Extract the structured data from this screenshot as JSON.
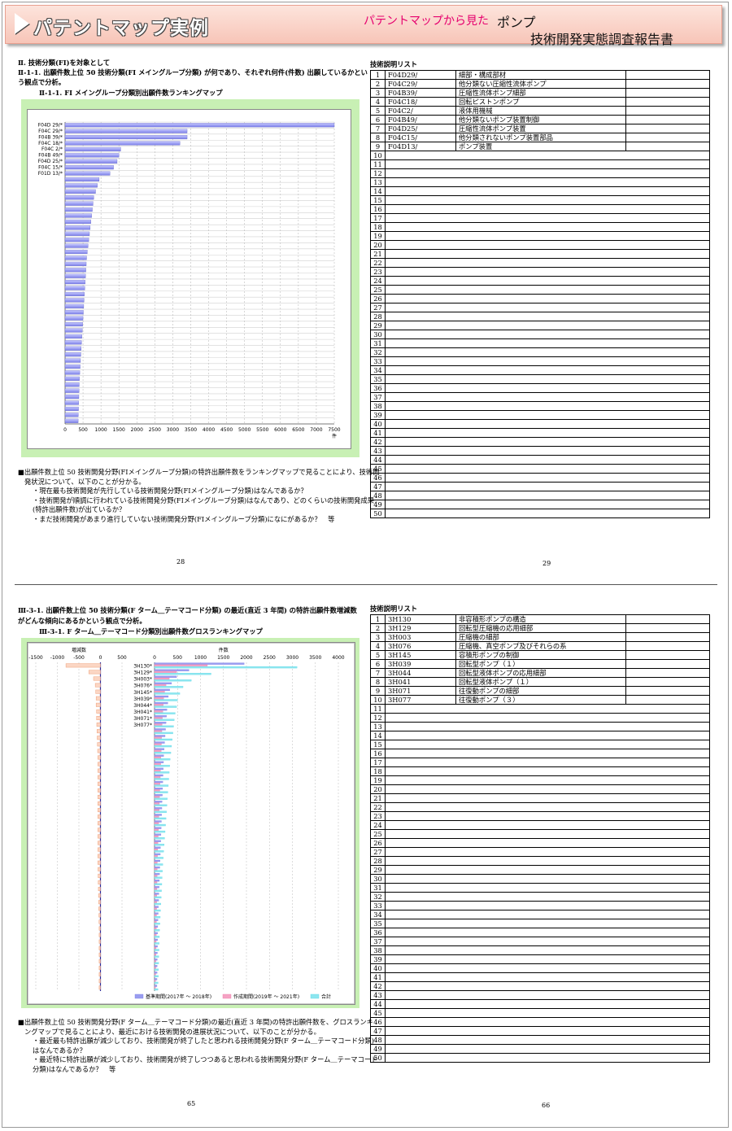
{
  "banner": {
    "title": "パテントマップ実例",
    "subtitle": "パテントマップから見た",
    "topic": "ポンプ",
    "report": "技術開発実態調査報告書"
  },
  "page1": {
    "heading": "Ⅱ. 技術分類(FI)を対象として",
    "q_line1": "Ⅱ-1-1. 出願件数上位 50 技術分類(FI メイングループ分類) が何であり、それぞれ何件(件数) 出願しているかとい",
    "q_line2": "う観点で分析。",
    "chart_caption": "Ⅱ-1-1. FI メイングループ分類別出願件数ランキングマップ",
    "desc_lines": [
      "■出願件数上位 50 技術開発分野(FIメイングループ分類)の特許出願件数をランキングマップで見ることにより、技術開",
      "発状況について、以下のことが分かる。",
      "・現在最も技術開発が先行している技術開発分野(FIメイングループ分類)はなんであるか？",
      "・技術開発が順調に行われている技術開発分野(FIメイングループ分類)はなんであり、どのくらいの技術開発成果",
      "(特許出願件数)が出ているか？",
      "・まだ技術開発があまり進行していない技術開発分野(FIメイングループ分類)になにがあるか？　等"
    ],
    "page_left": "28",
    "page_right": "29",
    "list_title": "技術説明リスト"
  },
  "page2": {
    "q_line1": "Ⅲ-3-1. 出願件数上位 50 技術分類(F ターム＿テーマコード分類) の最近(直近 3 年間) の特許出願件数増減数",
    "q_line2": "がどんな傾向にあるかという観点で分析。",
    "chart_caption": "Ⅲ-3-1. F ターム＿テーマコード分類別出願件数グロスランキングマップ",
    "desc_lines": [
      "■出願件数上位 50 技術開発分野(F ターム＿テーマコード分類)の最近(直近 3 年間)の特許出願件数を、グロスランキ",
      "ングマップで見ることにより、最近における技術開発の進展状況について、以下のことが分かる。",
      "・最近最も特許出願が減少しており、技術開発が終了したと思われる技術開発分野(F ターム＿テーマコード分類)",
      "はなんであるか？",
      "・最近特に特許出願が減少しており、技術開発が終了しつつあると思われる技術開発分野(F ターム＿テーマコード",
      "分類)はなんであるか？　等"
    ],
    "page_left": "65",
    "page_right": "66",
    "list_title": "技術説明リスト"
  },
  "chart_data": [
    {
      "type": "bar",
      "title": "",
      "xlabel": "件",
      "xlim": [
        0,
        7500
      ],
      "xticks": [
        0,
        500,
        1000,
        1500,
        2000,
        2500,
        3000,
        3500,
        4000,
        4500,
        5000,
        5500,
        6000,
        6500,
        7000,
        7500
      ],
      "categories": [
        "F04D 29/*",
        "F04C 29/*",
        "F04B 39/*",
        "F04C 18/*",
        "F04C  2/*",
        "F04B 49/*",
        "F04D 25/*",
        "F04C 15/*",
        "F01D 13/*"
      ],
      "values": [
        7500,
        3400,
        3400,
        3200,
        1550,
        1500,
        1450,
        1350,
        1250,
        950,
        900,
        850,
        800,
        780,
        760,
        740,
        720,
        700,
        680,
        660,
        640,
        620,
        600,
        590,
        580,
        570,
        560,
        550,
        540,
        530,
        520,
        510,
        500,
        490,
        480,
        470,
        460,
        450,
        440,
        430,
        420,
        410,
        400,
        395,
        390,
        385,
        380,
        375,
        370,
        365
      ]
    },
    {
      "type": "bar",
      "title": "",
      "xlabel": "件数",
      "x2label": "増減数",
      "xlim": [
        0,
        4000
      ],
      "xticks": [
        0,
        500,
        1000,
        1500,
        2000,
        2500,
        3000,
        3500,
        4000
      ],
      "diff_xlim": [
        -1500,
        500
      ],
      "diff_xticks": [
        -1500,
        -1000,
        -500,
        0,
        500
      ],
      "categories": [
        "3H130*",
        "3H129*",
        "3H003*",
        "3H076*",
        "3H145*",
        "3H039*",
        "3H044*",
        "3H041*",
        "3H071*",
        "3H077*"
      ],
      "legend": [
        "基準期間(2017年 〜 2018年)",
        "作成期間(2019年 〜 2021年)",
        "合計"
      ],
      "series": [
        {
          "name": "基準期間(2017年 〜 2018年)",
          "values": [
            1950,
            750,
            480,
            370,
            330,
            300,
            290,
            270,
            260,
            250,
            240,
            230,
            220,
            210,
            200,
            195,
            190,
            185,
            180,
            175,
            170,
            165,
            160,
            155,
            150,
            145,
            140,
            135,
            130,
            125,
            120,
            115,
            110,
            105,
            100,
            95,
            90,
            85,
            80,
            75,
            70,
            68,
            66,
            64,
            62,
            60,
            58,
            56,
            54,
            52
          ]
        },
        {
          "name": "作成期間(2019年 〜 2021年)",
          "values": [
            1150,
            480,
            320,
            250,
            220,
            200,
            190,
            180,
            170,
            165,
            160,
            155,
            150,
            145,
            140,
            135,
            130,
            125,
            120,
            115,
            110,
            105,
            100,
            95,
            90,
            85,
            80,
            75,
            70,
            65,
            60,
            58,
            56,
            54,
            52,
            50,
            48,
            46,
            44,
            42,
            40,
            38,
            36,
            34,
            32,
            30,
            28,
            26,
            24,
            22
          ]
        },
        {
          "name": "合計",
          "values": [
            3100,
            1230,
            800,
            620,
            550,
            500,
            480,
            450,
            430,
            415,
            400,
            385,
            370,
            355,
            340,
            330,
            320,
            310,
            300,
            290,
            280,
            270,
            260,
            250,
            240,
            230,
            220,
            210,
            200,
            190,
            180,
            173,
            166,
            159,
            152,
            145,
            138,
            131,
            124,
            117,
            110,
            106,
            102,
            98,
            94,
            90,
            86,
            82,
            78,
            74
          ]
        },
        {
          "name": "増減数",
          "values": [
            -800,
            -270,
            -160,
            -120,
            -110,
            -100,
            -100,
            -90,
            -90,
            -85,
            -80,
            -75,
            -70,
            -65,
            -60,
            -60,
            -60,
            -60,
            -60,
            -60,
            -60,
            -60,
            -60,
            -60,
            -60,
            -60,
            -60,
            -60,
            -60,
            -60,
            -60,
            -57,
            -54,
            -51,
            -48,
            -45,
            -42,
            -39,
            -36,
            -33,
            -30,
            -30,
            -30,
            -30,
            -30,
            -30,
            -30,
            -30,
            -30,
            -30
          ]
        }
      ]
    }
  ],
  "list1": {
    "rows": [
      {
        "n": "1",
        "code": "F04D29/",
        "desc": "細部・構成部材"
      },
      {
        "n": "2",
        "code": "F04C29/",
        "desc": "他分類ない圧縮性流体ポンプ"
      },
      {
        "n": "3",
        "code": "F04B39/",
        "desc": "圧縮性流体ポンプ細部"
      },
      {
        "n": "4",
        "code": "F04C18/",
        "desc": "回転ピストンポンプ"
      },
      {
        "n": "5",
        "code": "F04C2/",
        "desc": "液体用機械"
      },
      {
        "n": "6",
        "code": "F04B49/",
        "desc": "他分類ないポンプ装置制御"
      },
      {
        "n": "7",
        "code": "F04D25/",
        "desc": "圧縮性流体ポンプ装置"
      },
      {
        "n": "8",
        "code": "F04C15/",
        "desc": "他分類されないポンプ装置部品"
      },
      {
        "n": "9",
        "code": "F04D13/",
        "desc": "ポンプ装置"
      },
      {
        "n": "10",
        "code": "",
        "desc": ""
      },
      {
        "n": "11",
        "code": "",
        "desc": ""
      },
      {
        "n": "12",
        "code": "",
        "desc": ""
      },
      {
        "n": "13",
        "code": "",
        "desc": ""
      },
      {
        "n": "14",
        "code": "",
        "desc": ""
      },
      {
        "n": "15",
        "code": "",
        "desc": ""
      },
      {
        "n": "16",
        "code": "",
        "desc": ""
      },
      {
        "n": "17",
        "code": "",
        "desc": ""
      },
      {
        "n": "18",
        "code": "",
        "desc": ""
      },
      {
        "n": "19",
        "code": "",
        "desc": ""
      },
      {
        "n": "20",
        "code": "",
        "desc": ""
      },
      {
        "n": "21",
        "code": "",
        "desc": ""
      },
      {
        "n": "22",
        "code": "",
        "desc": ""
      },
      {
        "n": "23",
        "code": "",
        "desc": ""
      },
      {
        "n": "24",
        "code": "",
        "desc": ""
      },
      {
        "n": "25",
        "code": "",
        "desc": ""
      },
      {
        "n": "26",
        "code": "",
        "desc": ""
      },
      {
        "n": "27",
        "code": "",
        "desc": ""
      },
      {
        "n": "28",
        "code": "",
        "desc": ""
      },
      {
        "n": "29",
        "code": "",
        "desc": ""
      },
      {
        "n": "30",
        "code": "",
        "desc": ""
      },
      {
        "n": "31",
        "code": "",
        "desc": ""
      },
      {
        "n": "32",
        "code": "",
        "desc": ""
      },
      {
        "n": "33",
        "code": "",
        "desc": ""
      },
      {
        "n": "34",
        "code": "",
        "desc": ""
      },
      {
        "n": "35",
        "code": "",
        "desc": ""
      },
      {
        "n": "36",
        "code": "",
        "desc": ""
      },
      {
        "n": "37",
        "code": "",
        "desc": ""
      },
      {
        "n": "38",
        "code": "",
        "desc": ""
      },
      {
        "n": "39",
        "code": "",
        "desc": ""
      },
      {
        "n": "40",
        "code": "",
        "desc": ""
      },
      {
        "n": "41",
        "code": "",
        "desc": ""
      },
      {
        "n": "42",
        "code": "",
        "desc": ""
      },
      {
        "n": "43",
        "code": "",
        "desc": ""
      },
      {
        "n": "44",
        "code": "",
        "desc": ""
      },
      {
        "n": "45",
        "code": "",
        "desc": ""
      },
      {
        "n": "46",
        "code": "",
        "desc": ""
      },
      {
        "n": "47",
        "code": "",
        "desc": ""
      },
      {
        "n": "48",
        "code": "",
        "desc": ""
      },
      {
        "n": "49",
        "code": "",
        "desc": ""
      },
      {
        "n": "50",
        "code": "",
        "desc": ""
      }
    ]
  },
  "list2": {
    "rows": [
      {
        "n": "1",
        "code": "3H130",
        "desc": "非容積形ポンプの構造"
      },
      {
        "n": "2",
        "code": "3H129",
        "desc": "回転型圧縮機の応用細部"
      },
      {
        "n": "3",
        "code": "3H003",
        "desc": "圧縮機の細部"
      },
      {
        "n": "4",
        "code": "3H076",
        "desc": "圧縮機、真空ポンプ及びそれらの系"
      },
      {
        "n": "5",
        "code": "3H145",
        "desc": "容積形ポンプの制御"
      },
      {
        "n": "6",
        "code": "3H039",
        "desc": "回転型ポンプ（１）"
      },
      {
        "n": "7",
        "code": "3H044",
        "desc": "回転型液体ポンプの応用細部"
      },
      {
        "n": "8",
        "code": "3H041",
        "desc": "回転型液体ポンプ（１）"
      },
      {
        "n": "9",
        "code": "3H071",
        "desc": "往復動ポンプの細部"
      },
      {
        "n": "10",
        "code": "3H077",
        "desc": "往復動ポンプ（３）"
      },
      {
        "n": "11",
        "code": "",
        "desc": ""
      },
      {
        "n": "12",
        "code": "",
        "desc": ""
      },
      {
        "n": "13",
        "code": "",
        "desc": ""
      },
      {
        "n": "14",
        "code": "",
        "desc": ""
      },
      {
        "n": "15",
        "code": "",
        "desc": ""
      },
      {
        "n": "16",
        "code": "",
        "desc": ""
      },
      {
        "n": "17",
        "code": "",
        "desc": ""
      },
      {
        "n": "18",
        "code": "",
        "desc": ""
      },
      {
        "n": "19",
        "code": "",
        "desc": ""
      },
      {
        "n": "20",
        "code": "",
        "desc": ""
      },
      {
        "n": "21",
        "code": "",
        "desc": ""
      },
      {
        "n": "22",
        "code": "",
        "desc": ""
      },
      {
        "n": "23",
        "code": "",
        "desc": ""
      },
      {
        "n": "24",
        "code": "",
        "desc": ""
      },
      {
        "n": "25",
        "code": "",
        "desc": ""
      },
      {
        "n": "26",
        "code": "",
        "desc": ""
      },
      {
        "n": "27",
        "code": "",
        "desc": ""
      },
      {
        "n": "28",
        "code": "",
        "desc": ""
      },
      {
        "n": "29",
        "code": "",
        "desc": ""
      },
      {
        "n": "30",
        "code": "",
        "desc": ""
      },
      {
        "n": "31",
        "code": "",
        "desc": ""
      },
      {
        "n": "32",
        "code": "",
        "desc": ""
      },
      {
        "n": "33",
        "code": "",
        "desc": ""
      },
      {
        "n": "34",
        "code": "",
        "desc": ""
      },
      {
        "n": "35",
        "code": "",
        "desc": ""
      },
      {
        "n": "36",
        "code": "",
        "desc": ""
      },
      {
        "n": "37",
        "code": "",
        "desc": ""
      },
      {
        "n": "38",
        "code": "",
        "desc": ""
      },
      {
        "n": "39",
        "code": "",
        "desc": ""
      },
      {
        "n": "40",
        "code": "",
        "desc": ""
      },
      {
        "n": "41",
        "code": "",
        "desc": ""
      },
      {
        "n": "42",
        "code": "",
        "desc": ""
      },
      {
        "n": "43",
        "code": "",
        "desc": ""
      },
      {
        "n": "44",
        "code": "",
        "desc": ""
      },
      {
        "n": "45",
        "code": "",
        "desc": ""
      },
      {
        "n": "46",
        "code": "",
        "desc": ""
      },
      {
        "n": "47",
        "code": "",
        "desc": ""
      },
      {
        "n": "48",
        "code": "",
        "desc": ""
      },
      {
        "n": "49",
        "code": "",
        "desc": ""
      },
      {
        "n": "50",
        "code": "",
        "desc": ""
      }
    ]
  },
  "colors": {
    "bar_blue": "#7b7fe8",
    "bar_pink": "#f07aa8",
    "bar_cyan": "#58d8e8",
    "bar_orange": "#f0a078",
    "panel_green": "#c8f0b4",
    "banner_pink": "#f7c5b8",
    "subtitle_magenta": "#e6006e"
  }
}
